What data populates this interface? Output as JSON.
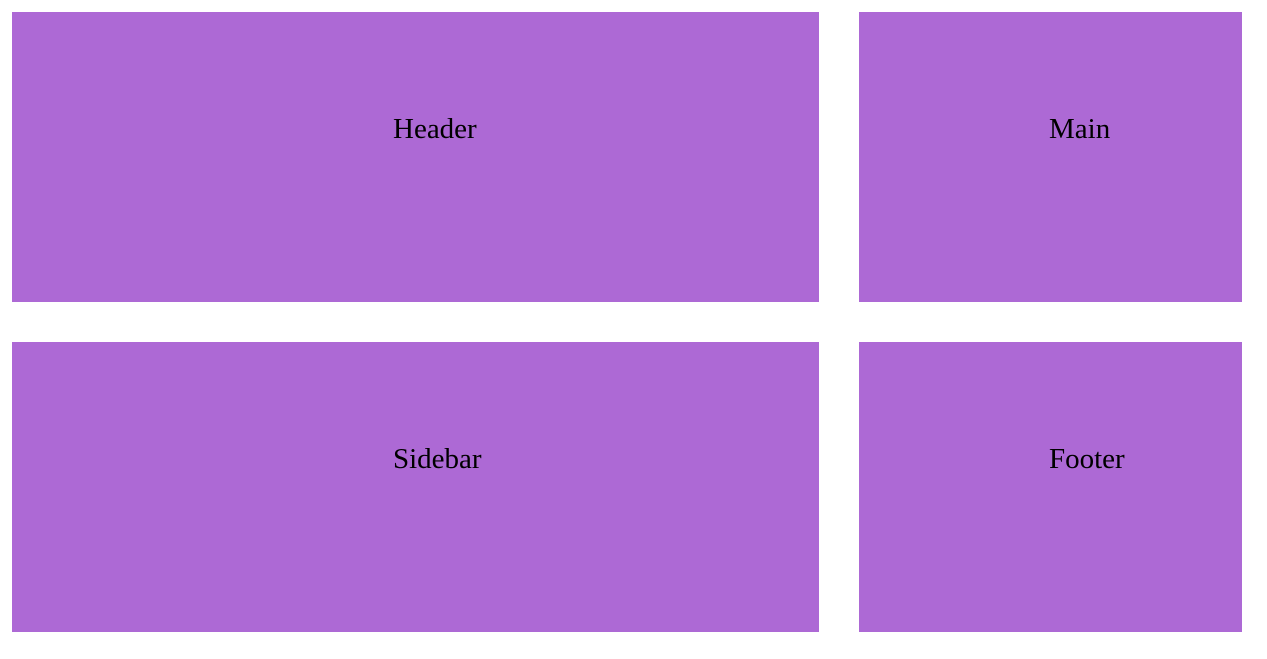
{
  "colors": {
    "box_background": "#ad69d5",
    "page_background": "#ffffff",
    "text": "#000000"
  },
  "grid": {
    "header_label": "Header",
    "main_label": "Main",
    "sidebar_label": "Sidebar",
    "footer_label": "Footer"
  }
}
